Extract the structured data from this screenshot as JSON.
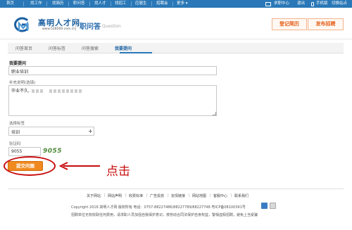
{
  "topnav": {
    "items": [
      "首页",
      "找工作",
      "找简历",
      "职问答",
      "找人才",
      "找招工",
      "应届生",
      "招聘会",
      "更多 ▾"
    ],
    "right": [
      "求职中心",
      "退出",
      "手机版",
      "切换站点"
    ]
  },
  "header": {
    "logo_title": "高明人才网",
    "logo_url": "www.528500.com.cn",
    "section_title": "职问答",
    "section_sub": "Question",
    "btn_resume": "登记简历",
    "btn_post_job": "发布招聘"
  },
  "tabs": [
    "问答首页",
    "问答标签",
    "问答搜索",
    "我要提问"
  ],
  "form": {
    "question_label": "我要提问",
    "question_value": "职业培训",
    "desc_label": "补充说明(选填)",
    "desc_value_prefix": "毕业不久,",
    "tag_label": "选择标签",
    "tag_value": "培训",
    "captcha_label": "验证码",
    "captcha_input": "9055",
    "captcha_image": "9055",
    "submit": "提交问题"
  },
  "annotation": {
    "hint": "点击"
  },
  "footer": {
    "links": [
      "关于网站",
      "网站声明",
      "收费标准",
      "广告投放",
      "友情链接",
      "网站地图",
      "客服中心",
      "联系我们"
    ],
    "copyright": "Copyright 2016 高明人才网 版权所有 电话：0757-88227486/88227789/88227748 粤ICP备08100391号",
    "notice": "招聘单位无权收取任何费用，请求职人员加强自我保护意识，按劳动合同法保护自身权益，警惕虚假招聘，避免上当受骗"
  },
  "colors": {
    "nav_bg": "#2a78b7",
    "accent": "#f08a20",
    "annotation_red": "#c80c0c"
  }
}
